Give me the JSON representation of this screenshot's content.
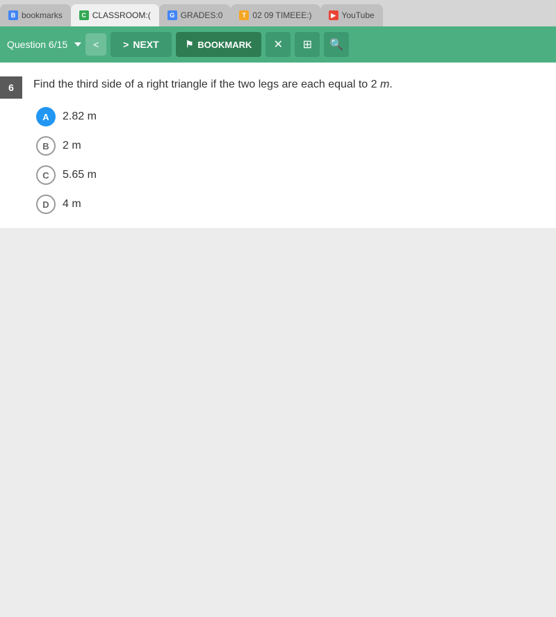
{
  "tabs": [
    {
      "id": "bookmarks",
      "label": "bookmarks",
      "icon": "B",
      "icon_color": "blue",
      "active": false
    },
    {
      "id": "classroom",
      "label": "CLASSROOM:(",
      "icon": "C",
      "icon_color": "green",
      "active": true
    },
    {
      "id": "grades",
      "label": "GRADES:0",
      "icon": "G",
      "icon_color": "blue",
      "active": false
    },
    {
      "id": "timeee",
      "label": "02 09 TIMEEE:)",
      "icon": "T",
      "icon_color": "orange",
      "active": false
    },
    {
      "id": "youtube",
      "label": "YouTube",
      "icon": "▶",
      "icon_color": "red",
      "active": false
    }
  ],
  "toolbar": {
    "question_label": "Question 6/15",
    "next_label": "NEXT",
    "bookmark_label": "BOOKMARK"
  },
  "question": {
    "number": "6",
    "text": "Find the third side of a right triangle if the two legs are each equal to 2",
    "text_variable": "m",
    "text_suffix": ".",
    "options": [
      {
        "id": "A",
        "text": "2.82 m",
        "selected": true
      },
      {
        "id": "B",
        "text": "2 m",
        "selected": false
      },
      {
        "id": "C",
        "text": "5.65 m",
        "selected": false
      },
      {
        "id": "D",
        "text": "4 m",
        "selected": false
      }
    ]
  }
}
